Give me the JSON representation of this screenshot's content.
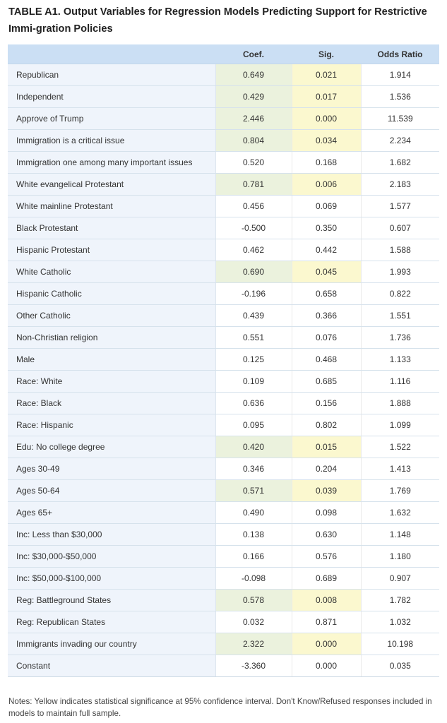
{
  "title": "TABLE A1. Output Variables for Regression Models Predicting Support for Restrictive Immi-gration Policies",
  "table": {
    "headers": [
      "",
      "Coef.",
      "Sig.",
      "Odds Ratio"
    ],
    "rows": [
      {
        "label": "Republican",
        "coef": "0.649",
        "sig": "0.021",
        "odds": "1.914",
        "significant": true
      },
      {
        "label": "Independent",
        "coef": "0.429",
        "sig": "0.017",
        "odds": "1.536",
        "significant": true
      },
      {
        "label": "Approve of Trump",
        "coef": "2.446",
        "sig": "0.000",
        "odds": "11.539",
        "significant": true
      },
      {
        "label": "Immigration is a critical issue",
        "coef": "0.804",
        "sig": "0.034",
        "odds": "2.234",
        "significant": true
      },
      {
        "label": "Immigration one among many important issues",
        "coef": "0.520",
        "sig": "0.168",
        "odds": "1.682",
        "significant": false
      },
      {
        "label": "White evangelical Protestant",
        "coef": "0.781",
        "sig": "0.006",
        "odds": "2.183",
        "significant": true
      },
      {
        "label": "White mainline Protestant",
        "coef": "0.456",
        "sig": "0.069",
        "odds": "1.577",
        "significant": false
      },
      {
        "label": "Black Protestant",
        "coef": "-0.500",
        "sig": "0.350",
        "odds": "0.607",
        "significant": false
      },
      {
        "label": "Hispanic Protestant",
        "coef": "0.462",
        "sig": "0.442",
        "odds": "1.588",
        "significant": false
      },
      {
        "label": "White Catholic",
        "coef": "0.690",
        "sig": "0.045",
        "odds": "1.993",
        "significant": true
      },
      {
        "label": "Hispanic Catholic",
        "coef": "-0.196",
        "sig": "0.658",
        "odds": "0.822",
        "significant": false
      },
      {
        "label": "Other Catholic",
        "coef": "0.439",
        "sig": "0.366",
        "odds": "1.551",
        "significant": false
      },
      {
        "label": "Non-Christian religion",
        "coef": "0.551",
        "sig": "0.076",
        "odds": "1.736",
        "significant": false
      },
      {
        "label": "Male",
        "coef": "0.125",
        "sig": "0.468",
        "odds": "1.133",
        "significant": false
      },
      {
        "label": "Race: White",
        "coef": "0.109",
        "sig": "0.685",
        "odds": "1.116",
        "significant": false
      },
      {
        "label": "Race: Black",
        "coef": "0.636",
        "sig": "0.156",
        "odds": "1.888",
        "significant": false
      },
      {
        "label": "Race: Hispanic",
        "coef": "0.095",
        "sig": "0.802",
        "odds": "1.099",
        "significant": false
      },
      {
        "label": "Edu: No college degree",
        "coef": "0.420",
        "sig": "0.015",
        "odds": "1.522",
        "significant": true
      },
      {
        "label": "Ages 30-49",
        "coef": "0.346",
        "sig": "0.204",
        "odds": "1.413",
        "significant": false
      },
      {
        "label": "Ages 50-64",
        "coef": "0.571",
        "sig": "0.039",
        "odds": "1.769",
        "significant": true
      },
      {
        "label": "Ages 65+",
        "coef": "0.490",
        "sig": "0.098",
        "odds": "1.632",
        "significant": false
      },
      {
        "label": "Inc: Less than $30,000",
        "coef": "0.138",
        "sig": "0.630",
        "odds": "1.148",
        "significant": false
      },
      {
        "label": "Inc: $30,000-$50,000",
        "coef": "0.166",
        "sig": "0.576",
        "odds": "1.180",
        "significant": false
      },
      {
        "label": "Inc: $50,000-$100,000",
        "coef": "-0.098",
        "sig": "0.689",
        "odds": "0.907",
        "significant": false
      },
      {
        "label": "Reg: Battleground States",
        "coef": "0.578",
        "sig": "0.008",
        "odds": "1.782",
        "significant": true
      },
      {
        "label": "Reg: Republican States",
        "coef": "0.032",
        "sig": "0.871",
        "odds": "1.032",
        "significant": false
      },
      {
        "label": "Immigrants invading our country",
        "coef": "2.322",
        "sig": "0.000",
        "odds": "10.198",
        "significant": true
      },
      {
        "label": "Constant",
        "coef": "-3.360",
        "sig": "0.000",
        "odds": "0.035",
        "significant": false
      }
    ]
  },
  "notes": "Notes: Yellow indicates statistical significance at 95% confidence interval. Don't Know/Refused responses included in models to maintain full sample.",
  "colors": {
    "header_bg": "#cbdff4",
    "label_bg": "#eff4fb",
    "coef_highlight": "#ebf2dd",
    "sig_highlight": "#fbf8cf"
  }
}
